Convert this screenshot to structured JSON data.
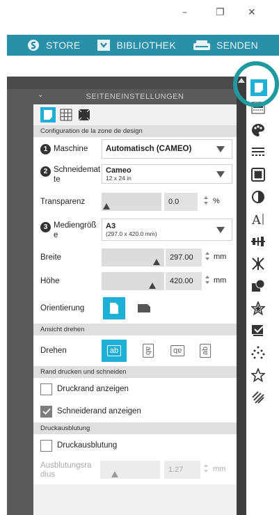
{
  "window": {
    "minimize": "–",
    "restore": "❐",
    "close": "✕"
  },
  "topbar": {
    "store": "STORE",
    "library": "BIBLIOTHEK",
    "send": "SENDEN",
    "color": "#2a8fa9"
  },
  "panel": {
    "title": "SEITENEINSTELLUNGEN",
    "section_design": "Configuration de la zone de design",
    "machine": {
      "num": "1",
      "label": "Maschine",
      "value": "Automatisch (CAMEO)"
    },
    "cutmat": {
      "num": "2",
      "label1": "Schneidemat",
      "label2": "te",
      "value": "Cameo",
      "sub": "12 x 24 in"
    },
    "transparency": {
      "label": "Transparenz",
      "value": "0.0",
      "unit": "%",
      "level": 0
    },
    "media": {
      "num": "3",
      "label1": "Mediengröß",
      "label2": "e",
      "value": "A3",
      "sub": "(297.0 x 420.0 mm)"
    },
    "width": {
      "label": "Breite",
      "value": "297.00",
      "unit": "mm"
    },
    "height": {
      "label": "Höhe",
      "value": "420.00",
      "unit": "mm"
    },
    "orientation": {
      "label": "Orientierung"
    },
    "section_rotate": "Ansicht drehen",
    "rotate": {
      "label": "Drehen",
      "opt1": "ab",
      "opt2": "ab",
      "opt3": "ab",
      "opt4": "ab"
    },
    "section_print": "Rand drucken und schneiden",
    "print_border": {
      "label": "Druckrand anzeigen",
      "checked": false
    },
    "cut_border": {
      "label": "Schneiderand anzeigen",
      "checked": true
    },
    "section_bleed": "Druckausblutung",
    "bleed": {
      "label": "Druckausblutung",
      "checked": false
    },
    "bleed_radius": {
      "label1": "Ausblutungsra",
      "label2": "dius",
      "value": "1.27",
      "unit": "mm"
    }
  },
  "accent": "#1fb0d8",
  "highlight_ring": "#1f9aa0"
}
